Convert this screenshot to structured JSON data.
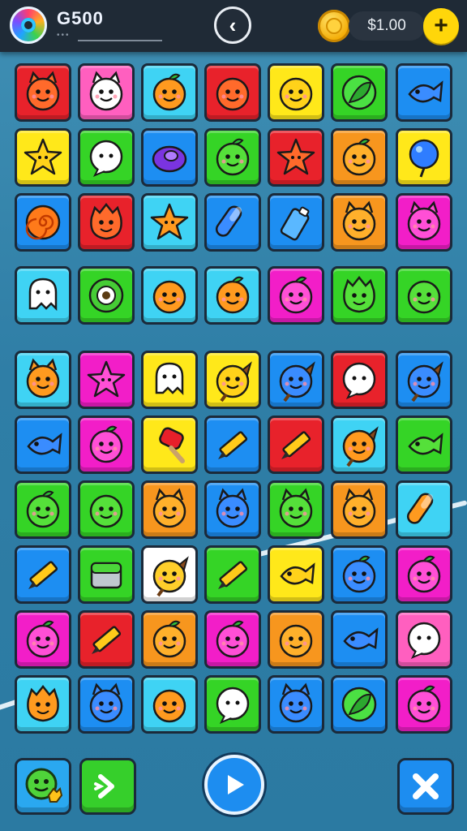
{
  "header": {
    "score": "G500",
    "progress_dots": "•••",
    "coins": "$1.00",
    "back_icon": "chevron-left-icon",
    "coin_icon": "coin-icon",
    "add_icon": "plus-icon"
  },
  "colors": {
    "red": "#e8222b",
    "pink": "#ff5fbf",
    "cyan": "#3fd3f4",
    "yellow": "#ffe81a",
    "green": "#35d426",
    "blue": "#1d8ef2",
    "orange": "#f7961e",
    "magenta": "#f21ec8",
    "white": "#ffffff"
  },
  "grid": {
    "rows": [
      [
        [
          "red",
          "cat"
        ],
        [
          "pink",
          "cat"
        ],
        [
          "cyan",
          "fruit"
        ],
        [
          "red",
          "face"
        ],
        [
          "yellow",
          "face"
        ],
        [
          "green",
          "leaf"
        ],
        [
          "blue",
          "fish"
        ]
      ],
      [
        [
          "yellow",
          "star"
        ],
        [
          "green",
          "bubble"
        ],
        [
          "blue",
          "donut"
        ],
        [
          "green",
          "fruit"
        ],
        [
          "red",
          "star"
        ],
        [
          "orange",
          "fruit"
        ],
        [
          "yellow",
          "balloon"
        ]
      ],
      [
        [
          "blue",
          "swirl"
        ],
        [
          "red",
          "monster"
        ],
        [
          "cyan",
          "star"
        ],
        [
          "blue",
          "candy"
        ],
        [
          "blue",
          "cup"
        ],
        [
          "orange",
          "cat"
        ],
        [
          "magenta",
          "cat"
        ]
      ],
      [
        [
          "cyan",
          "ghost"
        ],
        [
          "green",
          "eye"
        ],
        [
          "cyan",
          "face"
        ],
        [
          "cyan",
          "fruit"
        ],
        [
          "magenta",
          "fruit"
        ],
        [
          "green",
          "monster"
        ],
        [
          "green",
          "face"
        ]
      ],
      [
        [
          "cyan",
          "cat"
        ],
        [
          "magenta",
          "star"
        ],
        [
          "yellow",
          "ghost"
        ],
        [
          "yellow",
          "bird"
        ],
        [
          "blue",
          "bird"
        ],
        [
          "red",
          "bubble"
        ],
        [
          "blue",
          "bird"
        ]
      ],
      [
        [
          "blue",
          "fish"
        ],
        [
          "magenta",
          "fruit"
        ],
        [
          "yellow",
          "popsicle"
        ],
        [
          "blue",
          "pencil"
        ],
        [
          "red",
          "pencil"
        ],
        [
          "cyan",
          "bird"
        ],
        [
          "green",
          "fish"
        ]
      ],
      [
        [
          "green",
          "fruit"
        ],
        [
          "green",
          "face"
        ],
        [
          "orange",
          "cat"
        ],
        [
          "blue",
          "cat"
        ],
        [
          "green",
          "cat"
        ],
        [
          "orange",
          "cat"
        ],
        [
          "cyan",
          "candy"
        ]
      ],
      [
        [
          "blue",
          "pencil"
        ],
        [
          "green",
          "box"
        ],
        [
          "white",
          "bird"
        ],
        [
          "green",
          "pencil"
        ],
        [
          "yellow",
          "fish"
        ],
        [
          "blue",
          "fruit"
        ],
        [
          "magenta",
          "fruit"
        ]
      ],
      [
        [
          "magenta",
          "fruit"
        ],
        [
          "red",
          "pencil"
        ],
        [
          "orange",
          "fruit"
        ],
        [
          "magenta",
          "fruit"
        ],
        [
          "orange",
          "face"
        ],
        [
          "blue",
          "fish"
        ],
        [
          "pink",
          "bubble"
        ]
      ],
      [
        [
          "cyan",
          "monster"
        ],
        [
          "blue",
          "cat"
        ],
        [
          "cyan",
          "face"
        ],
        [
          "green",
          "bubble"
        ],
        [
          "blue",
          "cat"
        ],
        [
          "blue",
          "leaf"
        ],
        [
          "magenta",
          "fruit"
        ]
      ]
    ]
  },
  "bottom": {
    "buddy_icon": "dino-icon",
    "next_icon": "arrow-right-icon",
    "play_icon": "play-icon",
    "close_icon": "close-icon"
  }
}
